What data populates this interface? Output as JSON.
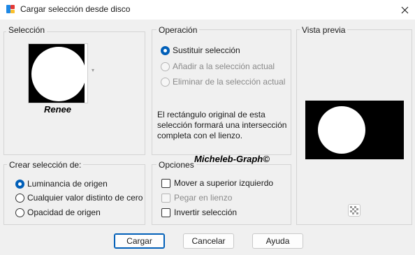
{
  "window": {
    "title": "Cargar selección desde disco"
  },
  "seleccion": {
    "title": "Selección",
    "thumbnail_caption": "Renee"
  },
  "operacion": {
    "title": "Operación",
    "options": [
      {
        "label": "Sustituir selección",
        "checked": true,
        "disabled": false
      },
      {
        "label": "Añadir a la selección actual",
        "checked": false,
        "disabled": true
      },
      {
        "label": "Eliminar de la selección actual",
        "checked": false,
        "disabled": true
      }
    ],
    "info": "El rectángulo original de esta selección formará una intersección completa con el lienzo."
  },
  "vista_previa": {
    "title": "Vista previa"
  },
  "crear": {
    "title": "Crear selección de:",
    "options": [
      {
        "label": "Luminancia de origen",
        "checked": true
      },
      {
        "label": "Cualquier valor distinto de cero",
        "checked": false
      },
      {
        "label": "Opacidad de origen",
        "checked": false
      }
    ]
  },
  "opciones": {
    "title": "Opciones",
    "items": [
      {
        "label": "Mover a superior izquierdo",
        "checked": false,
        "disabled": false
      },
      {
        "label": "Pegar en lienzo",
        "checked": false,
        "disabled": true
      },
      {
        "label": "Invertir selección",
        "checked": false,
        "disabled": false
      }
    ]
  },
  "watermark": "Micheleb-Graph©",
  "buttons": {
    "cargar": "Cargar",
    "cancelar": "Cancelar",
    "ayuda": "Ayuda"
  },
  "colors": {
    "accent": "#005fb8",
    "window_bg": "#f0f0f0",
    "group_border": "#d4d4d4"
  }
}
